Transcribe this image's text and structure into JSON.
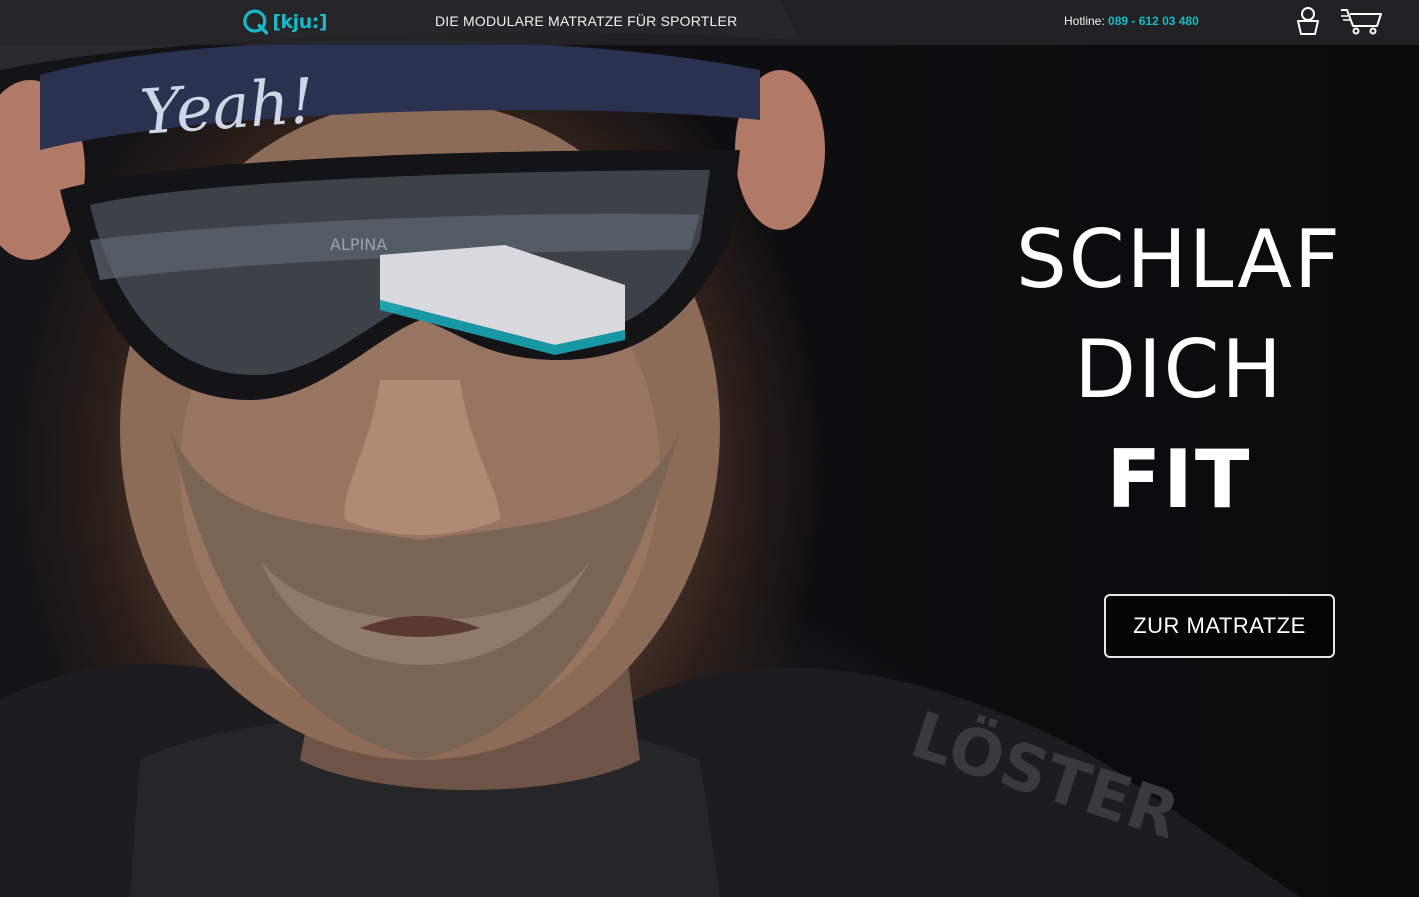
{
  "header": {
    "logo_text": "[kju:]",
    "tagline": "DIE MODULARE MATRATZE FÜR SPORTLER",
    "hotline_label": "Hotline:",
    "hotline_number": "089 - 612 03 480",
    "icons": {
      "account": "user-account-icon",
      "cart": "shopping-cart-icon"
    }
  },
  "hero": {
    "headline_line1": "SCHLAF",
    "headline_line2": "DICH",
    "headline_line3": "FIT",
    "cta_label": "ZUR MATRATZE",
    "photo_text": {
      "cap": "Yeah!",
      "glasses": "ALPINA",
      "jersey": "LÖSTER"
    }
  },
  "colors": {
    "accent": "#19b9c8",
    "topbar_bg": "#262628",
    "text": "#ffffff",
    "background": "#0b0b0c"
  }
}
